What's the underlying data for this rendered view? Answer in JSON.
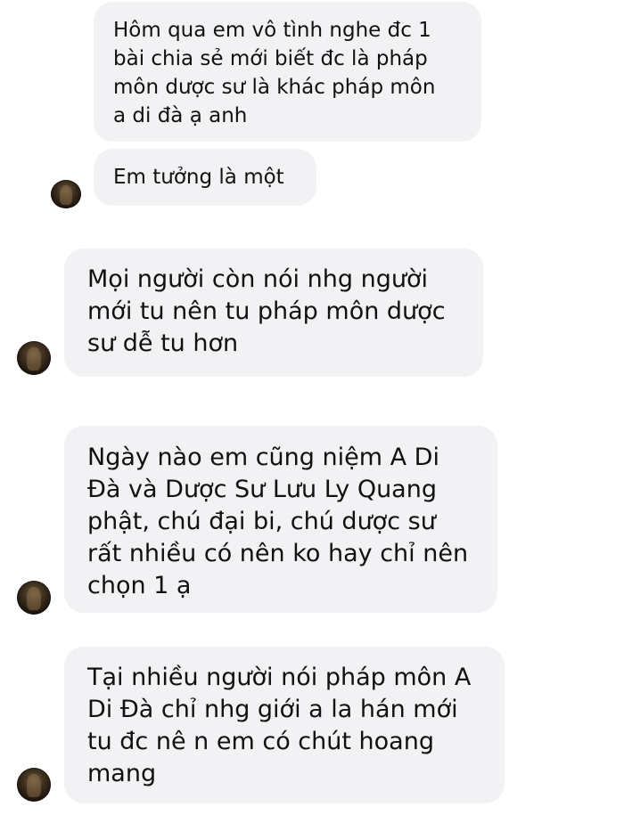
{
  "conversation": {
    "messages": [
      {
        "text": "Hôm qua em vô tình nghe đc 1\nbài chia sẻ mới biết đc là pháp\nmôn dược sư là khác pháp môn\na di đà ạ anh",
        "has_avatar": false
      },
      {
        "text": "Em tưởng là một",
        "has_avatar": true
      },
      {
        "text": "Mọi người còn nói nhg người\nmới tu nên tu pháp môn dược\nsư dễ tu hơn",
        "has_avatar": true
      },
      {
        "text": "Ngày nào em cũng niệm A Di\nĐà và Dược Sư Lưu Ly Quang\nphật, chú đại bi, chú dược sư\nrất nhiều có nên ko hay chỉ nên\nchọn 1 ạ",
        "has_avatar": true
      },
      {
        "text": "Tại nhiều người nói pháp môn A\nDi Đà chỉ nhg giới a la hán mới\ntu đc nê n em có chút hoang\nmang",
        "has_avatar": true
      }
    ]
  },
  "colors": {
    "background": "#ffffff",
    "bubble": "#f2f2f5",
    "text": "#111111"
  }
}
